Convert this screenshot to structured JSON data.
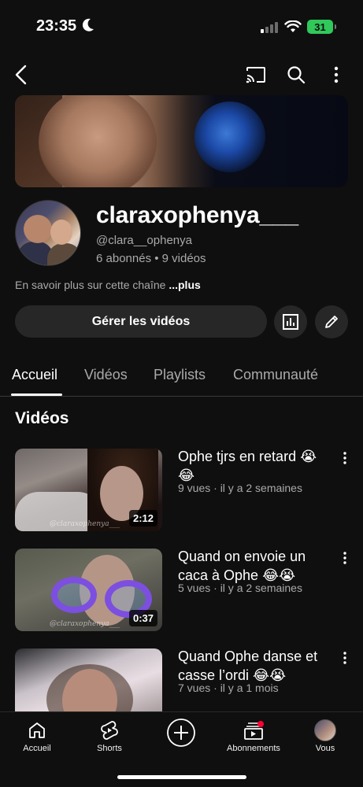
{
  "status_bar": {
    "time": "23:35",
    "battery": "31"
  },
  "channel": {
    "name": "claraxophenya___",
    "handle": "@clara__ophenya",
    "stats": "6 abonnés • 9 vidéos",
    "about": "En savoir plus sur cette chaîne",
    "about_more": "...plus"
  },
  "actions": {
    "manage_label": "Gérer les vidéos"
  },
  "tabs": [
    {
      "label": "Accueil",
      "active": true
    },
    {
      "label": "Vidéos"
    },
    {
      "label": "Playlists"
    },
    {
      "label": "Communauté"
    }
  ],
  "section_title": "Vidéos",
  "videos": [
    {
      "title": "Ophe tjrs en retard 😭😂",
      "meta": "9 vues · il y a 2 semaines",
      "duration": "2:12",
      "watermark": "@claraxophenya___"
    },
    {
      "title": "Quand on envoie un caca à Ophe 😂😭",
      "meta": "5 vues · il y a 2 semaines",
      "duration": "0:37",
      "watermark": "@claraxophenya___"
    },
    {
      "title": "Quand Ophe danse et casse l’ordi 😂😭",
      "meta": "7 vues · il y a 1 mois",
      "duration": "",
      "watermark": ""
    }
  ],
  "bottom_nav": [
    {
      "label": "Accueil",
      "icon": "home-icon"
    },
    {
      "label": "Shorts",
      "icon": "shorts-icon"
    },
    {
      "label": "",
      "icon": "create-icon"
    },
    {
      "label": "Abonnements",
      "icon": "subscriptions-icon"
    },
    {
      "label": "Vous",
      "icon": "avatar"
    }
  ]
}
